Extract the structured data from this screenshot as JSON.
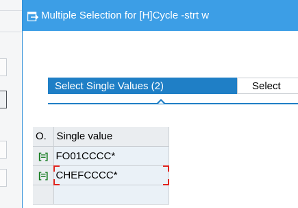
{
  "dialog": {
    "title": "Multiple Selection for [H]Cycle -strt w"
  },
  "tabs": [
    {
      "label": "Select Single Values (2)",
      "active": true
    },
    {
      "label": "Select",
      "active": false
    }
  ],
  "table": {
    "columns": [
      "O.",
      "Single value"
    ],
    "rows": [
      {
        "option_icon": "include-equal-icon",
        "option_glyph": "[=]",
        "value": "FO01CCCC*"
      },
      {
        "option_icon": "include-equal-icon",
        "option_glyph": "[=]",
        "value": "CHEFCCCC*"
      },
      {
        "option_icon": "",
        "option_glyph": "",
        "value": ""
      }
    ]
  },
  "colors": {
    "titlebar": "#3c9ee6",
    "active_tab": "#1f7fc6",
    "include_icon": "#137a1e",
    "focus_marker": "#e0231d"
  }
}
